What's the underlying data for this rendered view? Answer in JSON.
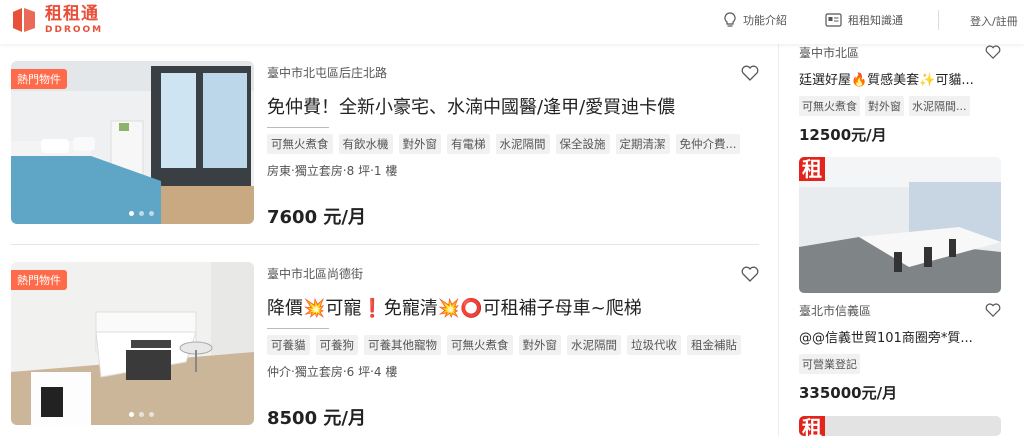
{
  "brand": {
    "name": "租租通",
    "sub": "DDROOM",
    "color": "#e8503a"
  },
  "nav": {
    "features": "功能介紹",
    "knowledge": "租租知識通",
    "login": "登入/註冊"
  },
  "listings": [
    {
      "badge": "熱門物件",
      "location": "臺中市北屯區后庄北路",
      "title": "免仲費！全新小豪宅、水湳中國醫/逢甲/愛買迪卡儂",
      "tags": [
        "可無火煮食",
        "有飲水機",
        "對外窗",
        "有電梯",
        "水泥隔間",
        "保全設施",
        "定期清潔",
        "免仲介費..."
      ],
      "meta": "房東‧獨立套房‧8 坪‧1 樓",
      "price": "7600 元/月"
    },
    {
      "badge": "熱門物件",
      "location": "臺中市北區尚德街",
      "title": "降價💥可寵❗免寵清💥⭕可租補子母車~爬梯",
      "tags": [
        "可養貓",
        "可養狗",
        "可養其他寵物",
        "可無火煮食",
        "對外窗",
        "水泥隔間",
        "垃圾代收",
        "租金補貼"
      ],
      "meta": "仲介‧獨立套房‧6 坪‧4 樓",
      "price": "8500 元/月"
    }
  ],
  "sidebar": [
    {
      "location": "臺中市北區",
      "title": "廷選好屋🔥質感美套✨可貓...",
      "tags": [
        "可無火煮食",
        "對外窗",
        "水泥隔間..."
      ],
      "price": "12500元/月"
    },
    {
      "badge": "租",
      "location": "臺北市信義區",
      "title": "@@信義世貿101商圈旁*質...",
      "tags": [
        "可營業登記"
      ],
      "price": "335000元/月"
    },
    {
      "badge": "租"
    }
  ]
}
